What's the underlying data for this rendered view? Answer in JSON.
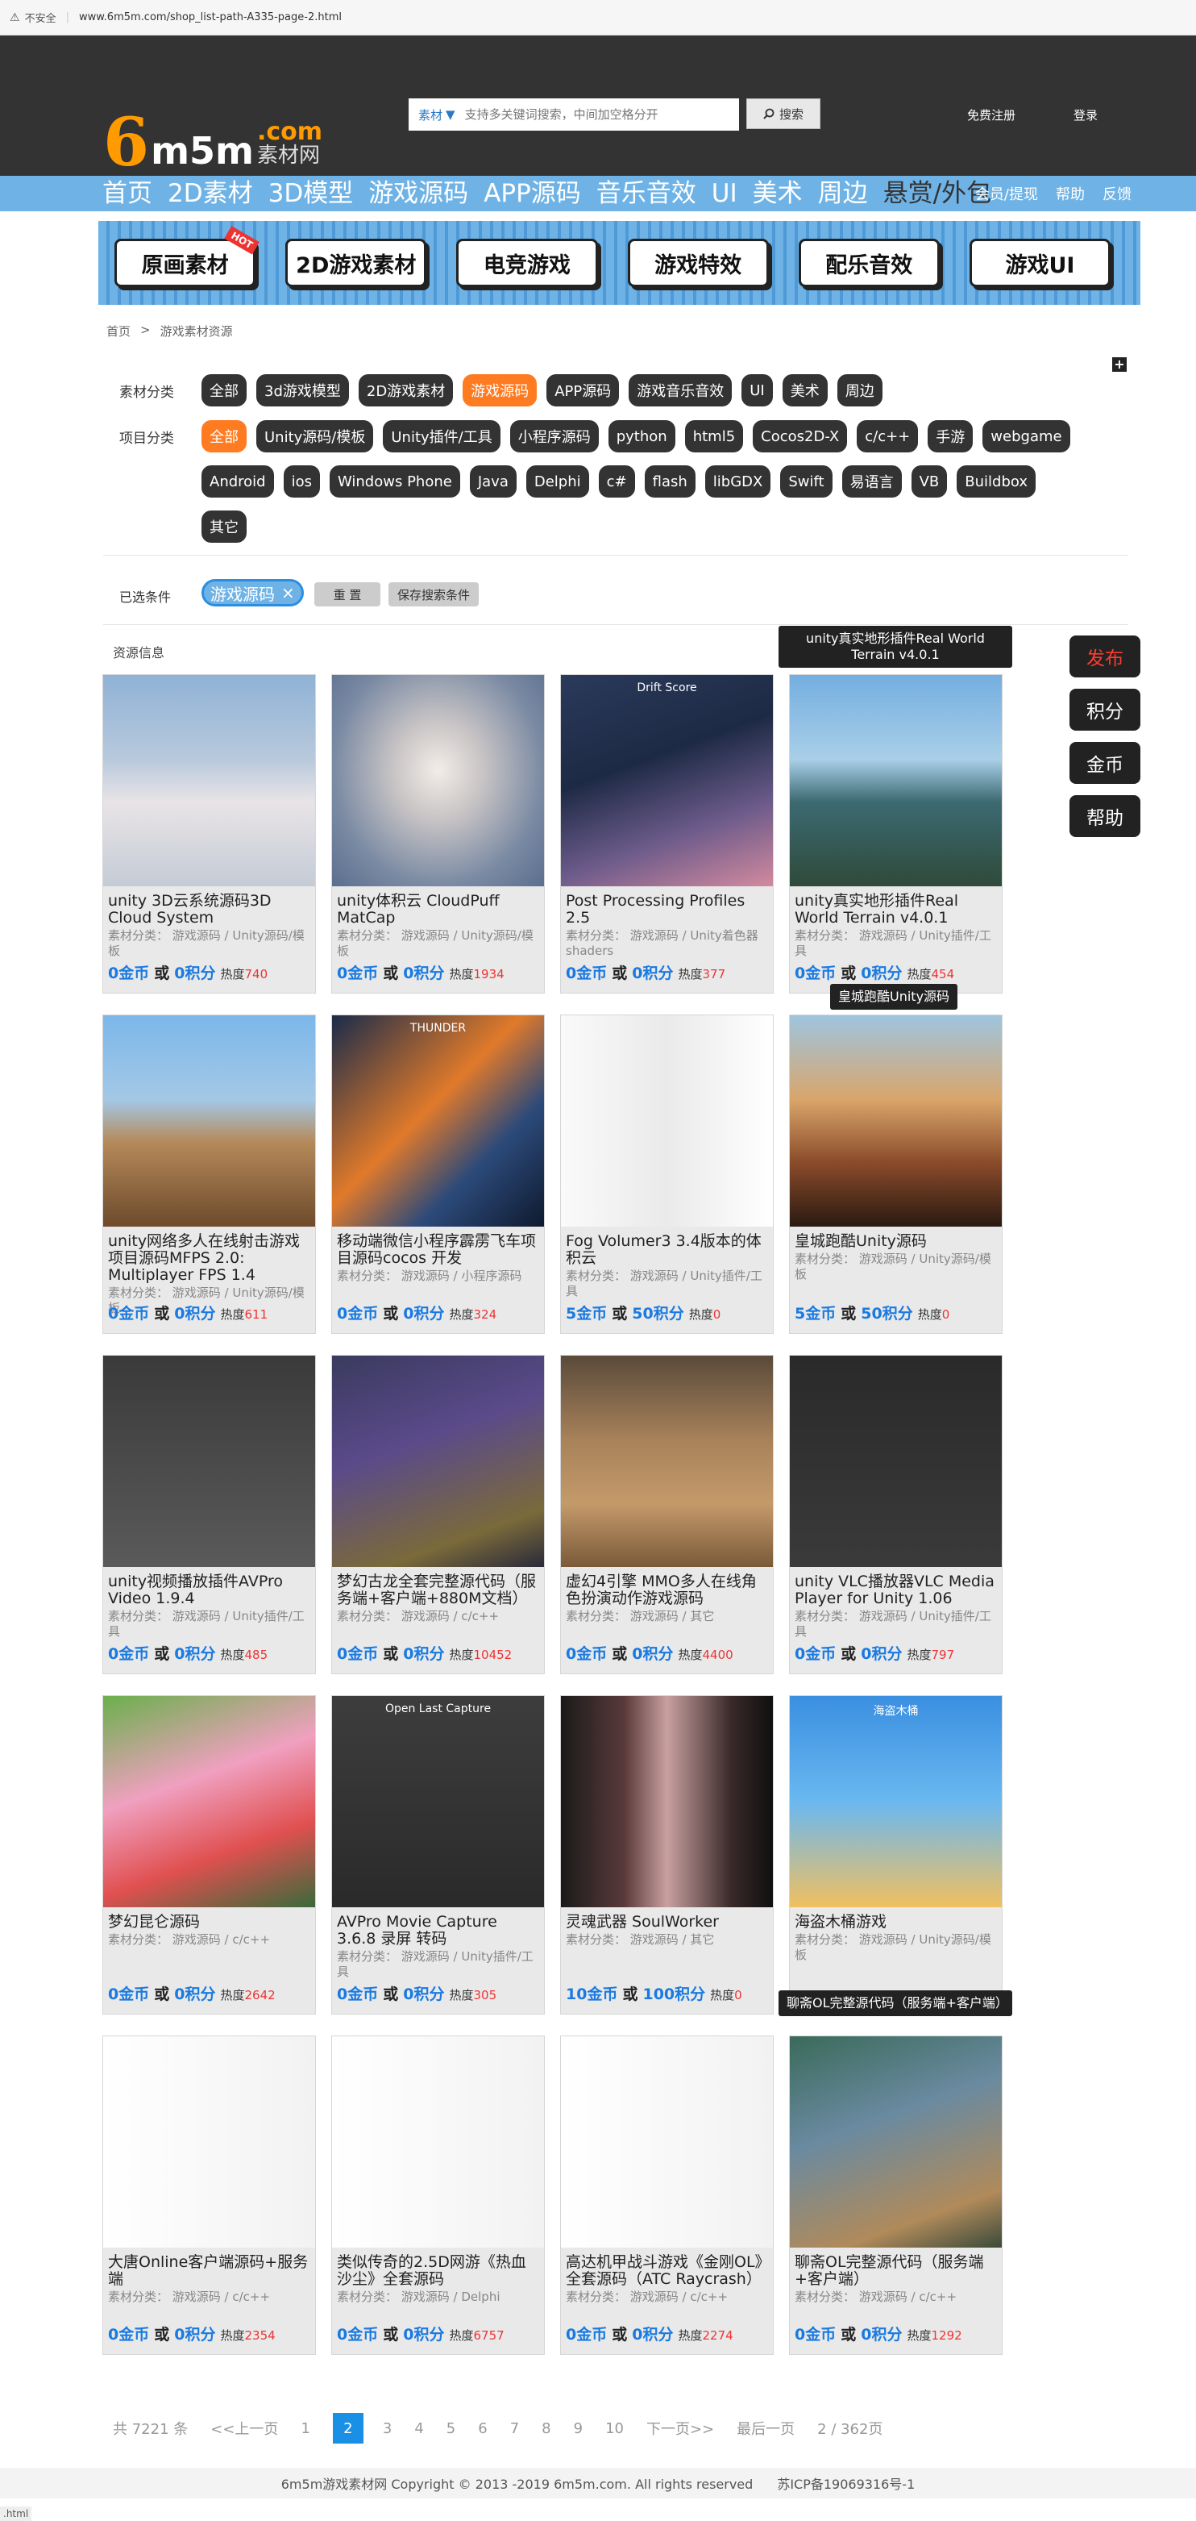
{
  "browser": {
    "insecure_label": "不安全",
    "url": "www.6m5m.com/shop_list-path-A335-page-2.html"
  },
  "header": {
    "logo": {
      "six": "6",
      "m5m": "m5m",
      "dotcom": ".com",
      "sub": "素材网"
    },
    "search": {
      "category": "素材",
      "placeholder": "支持多关键词搜索，中间加空格分开",
      "button": "搜索"
    },
    "register": "免费注册",
    "login": "登录"
  },
  "nav": {
    "items": [
      "首页",
      "2D素材",
      "3D模型",
      "游戏源码",
      "APP源码",
      "音乐音效",
      "UI",
      "美术",
      "周边",
      "悬赏/外包"
    ],
    "links": [
      "会员/提现",
      "帮助",
      "反馈"
    ]
  },
  "banner_tabs": [
    "原画素材",
    "2D游戏素材",
    "电竞游戏",
    "游戏特效",
    "配乐音效",
    "游戏UI"
  ],
  "banner_hot": "HOT",
  "breadcrumb": [
    "首页",
    ">",
    "游戏素材资源"
  ],
  "filters": {
    "category_label": "素材分类",
    "categories": [
      "全部",
      "3d游戏模型",
      "2D游戏素材",
      "游戏源码",
      "APP源码",
      "游戏音乐音效",
      "UI",
      "美术",
      "周边"
    ],
    "category_selected": 3,
    "project_label": "项目分类",
    "projects": [
      "全部",
      "Unity源码/模板",
      "Unity插件/工具",
      "小程序源码",
      "python",
      "html5",
      "Cocos2D-X",
      "c/c++",
      "手游",
      "webgame",
      "Android",
      "ios",
      "Windows Phone",
      "Java",
      "Delphi",
      "c#",
      "flash",
      "libGDX",
      "Swift",
      "易语言",
      "VB",
      "Buildbox",
      "其它"
    ],
    "project_selected": 0,
    "selected_label": "已选条件",
    "selected_chip": "游戏源码",
    "reset": "重 置",
    "save": "保存搜索条件"
  },
  "results_label": "资源信息",
  "side_buttons": [
    "发布",
    "积分",
    "金币",
    "帮助"
  ],
  "cards": [
    {
      "title": "unity 3D云系统源码3D Cloud System",
      "meta": "素材分类： 游戏源码 / Unity源码/模板",
      "gold": "0金币",
      "pts": "0积分",
      "heat": "740",
      "cap": ""
    },
    {
      "title": "unity体积云 CloudPuff MatCap",
      "meta": "素材分类： 游戏源码 / Unity源码/模板",
      "gold": "0金币",
      "pts": "0积分",
      "heat": "1934",
      "cap": ""
    },
    {
      "title": "Post Processing Profiles 2.5",
      "meta": "素材分类： 游戏源码 / Unity着色器shaders",
      "gold": "0金币",
      "pts": "0积分",
      "heat": "377",
      "cap": "Drift Score"
    },
    {
      "title": "unity真实地形插件Real World Terrain v4.0.1",
      "meta": "素材分类： 游戏源码 / Unity插件/工具",
      "gold": "0金币",
      "pts": "0积分",
      "heat": "454",
      "cap": ""
    },
    {
      "title": "unity网络多人在线射击游戏项目源码MFPS 2.0: Multiplayer FPS 1.4",
      "meta": "素材分类： 游戏源码 / Unity源码/模板",
      "gold": "0金币",
      "pts": "0积分",
      "heat": "611",
      "cap": ""
    },
    {
      "title": "移动端微信小程序霹雳飞车项目源码cocos 开发",
      "meta": "素材分类： 游戏源码 / 小程序源码",
      "gold": "0金币",
      "pts": "0积分",
      "heat": "324",
      "cap": "THUNDER"
    },
    {
      "title": "Fog Volumer3 3.4版本的体积云",
      "meta": "素材分类： 游戏源码 / Unity插件/工具",
      "gold": "5金币",
      "pts": "50积分",
      "heat": "0",
      "cap": ""
    },
    {
      "title": "皇城跑酷Unity源码",
      "meta": "素材分类： 游戏源码 / Unity源码/模板",
      "gold": "5金币",
      "pts": "50积分",
      "heat": "0",
      "cap": ""
    },
    {
      "title": "unity视频播放插件AVPro Video 1.9.4",
      "meta": "素材分类： 游戏源码 / Unity插件/工具",
      "gold": "0金币",
      "pts": "0积分",
      "heat": "485",
      "cap": ""
    },
    {
      "title": "梦幻古龙全套完整源代码（服务端+客户端+880M文档）",
      "meta": "素材分类： 游戏源码 / c/c++",
      "gold": "0金币",
      "pts": "0积分",
      "heat": "10452",
      "cap": ""
    },
    {
      "title": "虚幻4引擎 MMO多人在线角色扮演动作游戏源码",
      "meta": "素材分类： 游戏源码 / 其它",
      "gold": "0金币",
      "pts": "0积分",
      "heat": "4400",
      "cap": ""
    },
    {
      "title": "unity VLC播放器VLC Media Player for Unity 1.06",
      "meta": "素材分类： 游戏源码 / Unity插件/工具",
      "gold": "0金币",
      "pts": "0积分",
      "heat": "797",
      "cap": ""
    },
    {
      "title": "梦幻昆仑源码",
      "meta": "素材分类： 游戏源码 / c/c++",
      "gold": "0金币",
      "pts": "0积分",
      "heat": "2642",
      "cap": ""
    },
    {
      "title": "AVPro Movie Capture 3.6.8 录屏 转码",
      "meta": "素材分类： 游戏源码 / Unity插件/工具",
      "gold": "0金币",
      "pts": "0积分",
      "heat": "305",
      "cap": "Open Last Capture"
    },
    {
      "title": "灵魂武器 SoulWorker",
      "meta": "素材分类： 游戏源码 / 其它",
      "gold": "10金币",
      "pts": "100积分",
      "heat": "0",
      "cap": ""
    },
    {
      "title": "海盗木桶游戏",
      "meta": "素材分类： 游戏源码 / Unity源码/模板",
      "gold": "",
      "pts": "",
      "heat": "",
      "cap": "海盗木桶"
    },
    {
      "title": "大唐Online客户端源码+服务端",
      "meta": "素材分类： 游戏源码 / c/c++",
      "gold": "0金币",
      "pts": "0积分",
      "heat": "2354",
      "cap": ""
    },
    {
      "title": "类似传奇的2.5D网游《热血沙尘》全套源码",
      "meta": "素材分类： 游戏源码 / Delphi",
      "gold": "0金币",
      "pts": "0积分",
      "heat": "6757",
      "cap": ""
    },
    {
      "title": "高达机甲战斗游戏《金刚OL》全套源码（ATC Raycrash）",
      "meta": "素材分类： 游戏源码 / c/c++",
      "gold": "0金币",
      "pts": "0积分",
      "heat": "2274",
      "cap": ""
    },
    {
      "title": "聊斋OL完整源代码（服务端+客户端）",
      "meta": "素材分类： 游戏源码 / c/c++",
      "gold": "0金币",
      "pts": "0积分",
      "heat": "1292",
      "cap": ""
    }
  ],
  "price_or": "或",
  "heat_label": "热度",
  "tooltips": [
    "unity真实地形插件Real World Terrain v4.0.1",
    "皇城跑酷Unity源码",
    "聊斋OL完整源代码（服务端+客户端）"
  ],
  "pager": {
    "total": "共  7221  条",
    "prev": "<<上一页",
    "pages": [
      "1",
      "2",
      "3",
      "4",
      "5",
      "6",
      "7",
      "8",
      "9",
      "10"
    ],
    "current": "2",
    "next": "下一页>>",
    "last": "最后一页",
    "pageinfo": "2 / 362页"
  },
  "footer": {
    "copyright": "6m5m游戏素材网 Copyright © 2013 -2019 6m5m.com. All rights reserved",
    "icp": "苏ICP备19069316号-1"
  },
  "status": ".html",
  "colors": {
    "header_bg": "#333333",
    "nav_bg": "#6fb3e6",
    "accent_orange": "#ff7b22",
    "price_blue": "#1a7ae0",
    "heat_red": "#ee3333"
  }
}
